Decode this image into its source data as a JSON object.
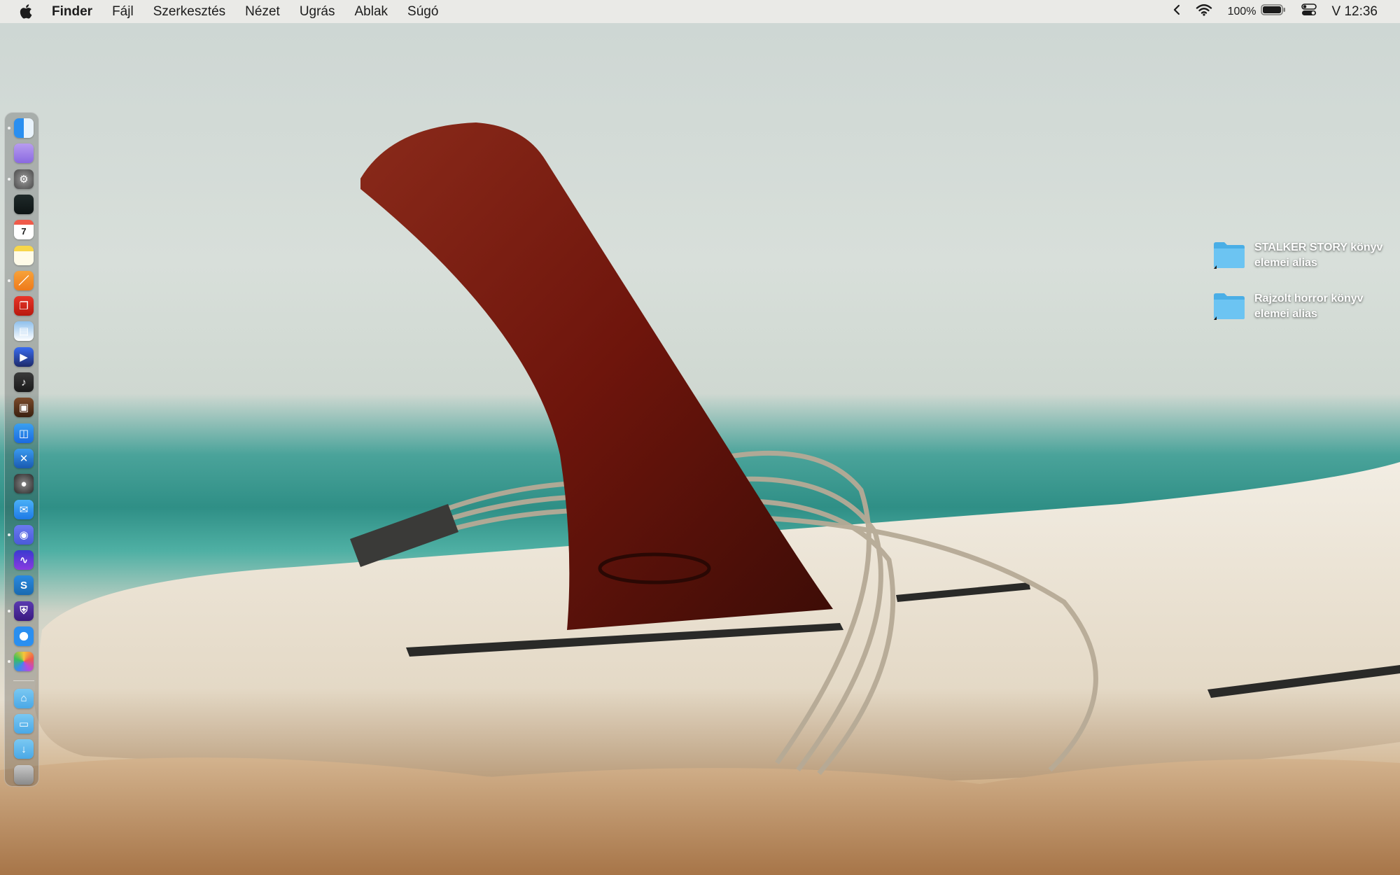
{
  "menubar": {
    "app_name": "Finder",
    "items": [
      "Fájl",
      "Szerkesztés",
      "Nézet",
      "Ugrás",
      "Ablak",
      "Súgó"
    ],
    "battery_percent": "100%",
    "clock": "V 12:36"
  },
  "desktop": {
    "items": [
      {
        "label_line1": "STALKER STORY könyv",
        "label_line2": "elemei alias"
      },
      {
        "label_line1": "Rajzolt horror könyv",
        "label_line2": "elemei alias"
      }
    ]
  },
  "dock": {
    "apps": [
      {
        "icon": "finder-icon",
        "running": true
      },
      {
        "icon": "notes-purple-icon",
        "running": false
      },
      {
        "icon": "system-settings-icon",
        "running": true
      },
      {
        "icon": "activity-monitor-icon",
        "running": false
      },
      {
        "icon": "calendar-icon",
        "day": "7",
        "running": false
      },
      {
        "icon": "notes-icon",
        "running": false
      },
      {
        "icon": "pages-icon",
        "running": true
      },
      {
        "icon": "pdf-reader-icon",
        "running": false
      },
      {
        "icon": "preview-icon",
        "running": false
      },
      {
        "icon": "media-player-icon",
        "running": false
      },
      {
        "icon": "logic-icon",
        "running": false
      },
      {
        "icon": "photo-booth-icon",
        "running": false
      },
      {
        "icon": "app-store-icon",
        "running": false
      },
      {
        "icon": "xcode-icon",
        "running": false
      },
      {
        "icon": "camera-app-icon",
        "running": false
      },
      {
        "icon": "mail-icon",
        "running": false
      },
      {
        "icon": "discord-icon",
        "running": true
      },
      {
        "icon": "stocks-icon",
        "running": false
      },
      {
        "icon": "skype-icon",
        "running": false
      },
      {
        "icon": "vpn-shield-icon",
        "running": true
      },
      {
        "icon": "safari-icon",
        "running": false
      },
      {
        "icon": "photos-icon",
        "running": true
      }
    ],
    "folders": [
      {
        "icon": "applications-folder-icon"
      },
      {
        "icon": "documents-folder-icon"
      },
      {
        "icon": "downloads-folder-icon"
      }
    ],
    "trash": {
      "icon": "trash-icon"
    }
  }
}
